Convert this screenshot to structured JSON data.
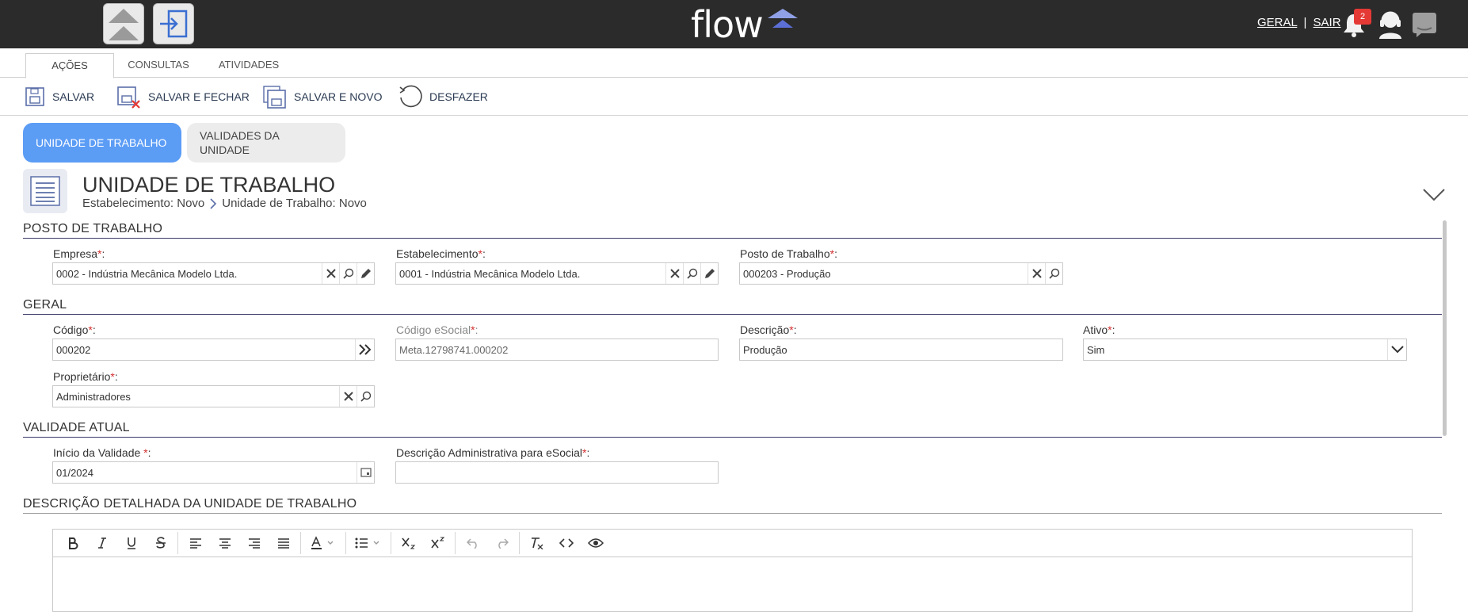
{
  "topbar": {
    "logo_text": "flow",
    "link_geral": "GERAL",
    "separator": "|",
    "link_sair": "SAIR",
    "notification_count": "2"
  },
  "tabs": [
    {
      "label": "AÇÕES",
      "active": true
    },
    {
      "label": "CONSULTAS",
      "active": false
    },
    {
      "label": "ATIVIDADES",
      "active": false
    }
  ],
  "toolbar": {
    "save": "SALVAR",
    "save_close": "SALVAR E FECHAR",
    "save_new": "SALVAR E NOVO",
    "undo": "DESFAZER"
  },
  "section_tabs": {
    "active": "UNIDADE DE TRABALHO",
    "inactive_line1": "VALIDADES DA",
    "inactive_line2": "UNIDADE"
  },
  "header": {
    "title": "UNIDADE DE TRABALHO",
    "breadcrumb_1": "Estabelecimento: Novo",
    "breadcrumb_2": "Unidade de Trabalho: Novo"
  },
  "posto": {
    "section": "POSTO DE TRABALHO",
    "empresa_label": "Empresa",
    "empresa_value": "0002 - Indústria Mecânica Modelo Ltda.",
    "estab_label": "Estabelecimento",
    "estab_value": "0001 - Indústria Mecânica Modelo Ltda.",
    "posto_label": "Posto de Trabalho",
    "posto_value": "000203 - Produção"
  },
  "geral": {
    "section": "GERAL",
    "codigo_label": "Código",
    "codigo_value": "000202",
    "esocial_label": "Código eSocial",
    "esocial_value": "Meta.12798741.000202",
    "descricao_label": "Descrição",
    "descricao_value": "Produção",
    "ativo_label": "Ativo",
    "ativo_value": "Sim",
    "proprietario_label": "Proprietário",
    "proprietario_value": "Administradores"
  },
  "validade": {
    "section": "VALIDADE ATUAL",
    "inicio_label": "Início da Validade ",
    "inicio_value": "01/2024",
    "descadm_label": "Descrição Administrativa para eSocial",
    "descadm_value": ""
  },
  "detalhada": {
    "section": "DESCRIÇÃO DETALHADA DA UNIDADE DE TRABALHO"
  },
  "required_mark": "*",
  "colon": ":"
}
